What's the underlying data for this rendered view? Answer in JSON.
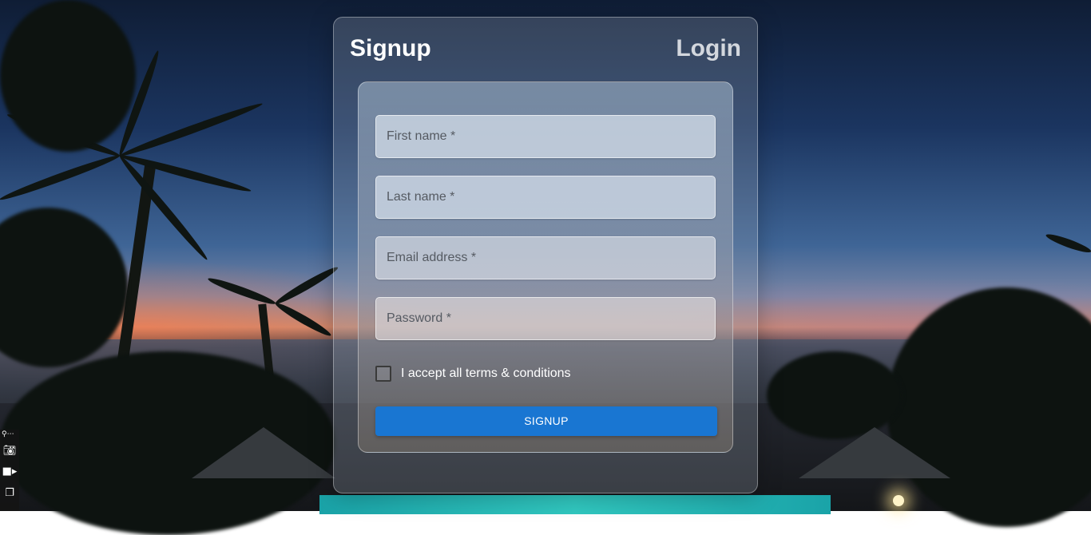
{
  "tabs": {
    "signup": "Signup",
    "login": "Login"
  },
  "form": {
    "first_name_placeholder": "First name *",
    "last_name_placeholder": "Last name *",
    "email_placeholder": "Email address *",
    "password_placeholder": "Password *",
    "terms_label": "I accept all terms & conditions",
    "terms_checked": false,
    "submit_label": "SIGNUP"
  },
  "colors": {
    "primary": "#1976d2",
    "active_tab": "#ffffff",
    "inactive_tab": "#d3d7de"
  },
  "icons": [
    "camera-icon",
    "video-icon",
    "window-icon"
  ]
}
